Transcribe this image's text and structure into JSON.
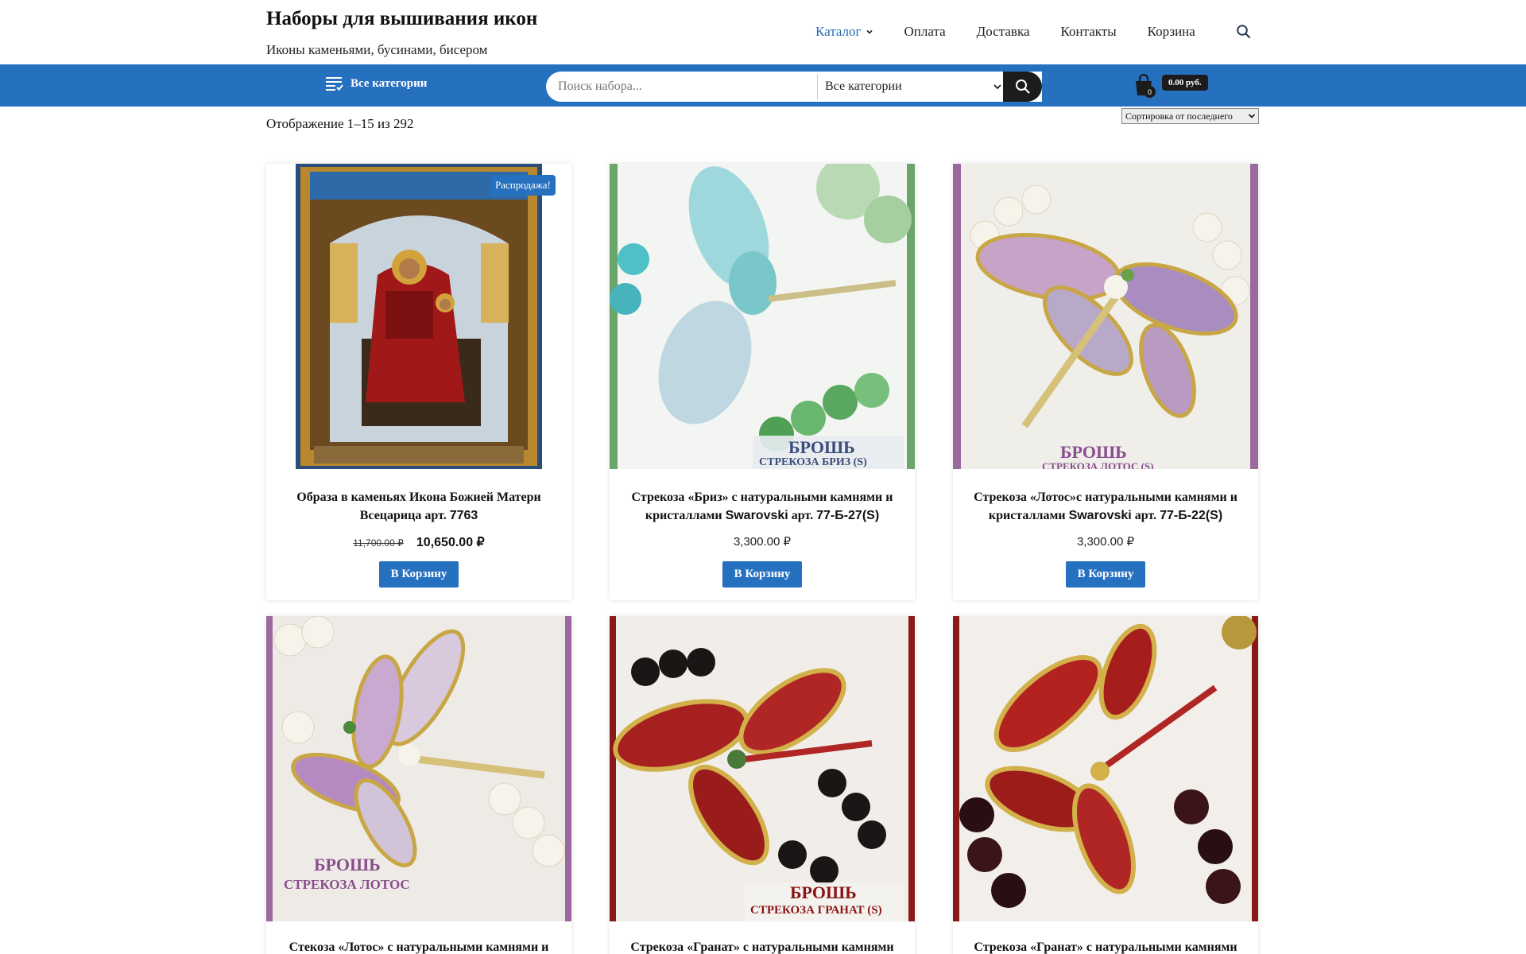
{
  "site": {
    "title": "Наборы для вышивания икон",
    "tagline": "Иконы каменьями, бусинами, бисером"
  },
  "nav": {
    "items": [
      {
        "label": "Каталог",
        "active": true
      },
      {
        "label": "Оплата"
      },
      {
        "label": "Доставка"
      },
      {
        "label": "Контакты"
      },
      {
        "label": "Корзина"
      }
    ],
    "search_icon": "search-icon"
  },
  "bar": {
    "all_categories": "Все категории",
    "search_placeholder": "Поиск набора...",
    "category_select": "Все категории",
    "cart_count": "0",
    "cart_total": "0.00 руб."
  },
  "shop": {
    "result_count": "Отображение 1–15 из 292",
    "sort_label": "Сортировка от последнего"
  },
  "colors": {
    "accent": "#2670c0",
    "dark": "#1b1b1b"
  },
  "products": [
    {
      "title_a": "Образа в каменьях Икона Божией Матери Всецарица арт. ",
      "title_b": "7763",
      "price_old": "11,700.00 ₽",
      "price": "10,650.00 ₽",
      "badge": "Распродажа!",
      "button": "В Корзину"
    },
    {
      "title_a": "Стрекоза «Бриз» с натуральными камнями и кристаллами ",
      "title_b": "Swarovski",
      "title_c": " арт. ",
      "title_d": "77-Б-27(S)",
      "price": "3,300.00 ₽",
      "button": "В Корзину",
      "caption_line1": "БРОШЬ",
      "caption_line2": "СТРЕКОЗА БРИЗ (S)"
    },
    {
      "title_a": "Стрекоза «Лотос»с натуральными камнями и кристаллами ",
      "title_b": "Swarovski",
      "title_c": " арт. ",
      "title_d": "77-Б-22(S)",
      "price": "3,300.00 ₽",
      "button": "В Корзину",
      "caption_line1": "БРОШЬ",
      "caption_line2": "СТРЕКОЗА ЛОТОС (S)"
    },
    {
      "title": "Стекоза «Лотос» с натуральными камнями и",
      "caption_line1": "БРОШЬ",
      "caption_line2": "СТРЕКОЗА ЛОТОС"
    },
    {
      "title": "Стрекоза «Гранат» с натуральными камнями и",
      "caption_line1": "БРОШЬ",
      "caption_line2": "СТРЕКОЗА ГРАНАТ (S)"
    },
    {
      "title": "Стрекоза «Гранат» с натуральными камнями и"
    }
  ]
}
